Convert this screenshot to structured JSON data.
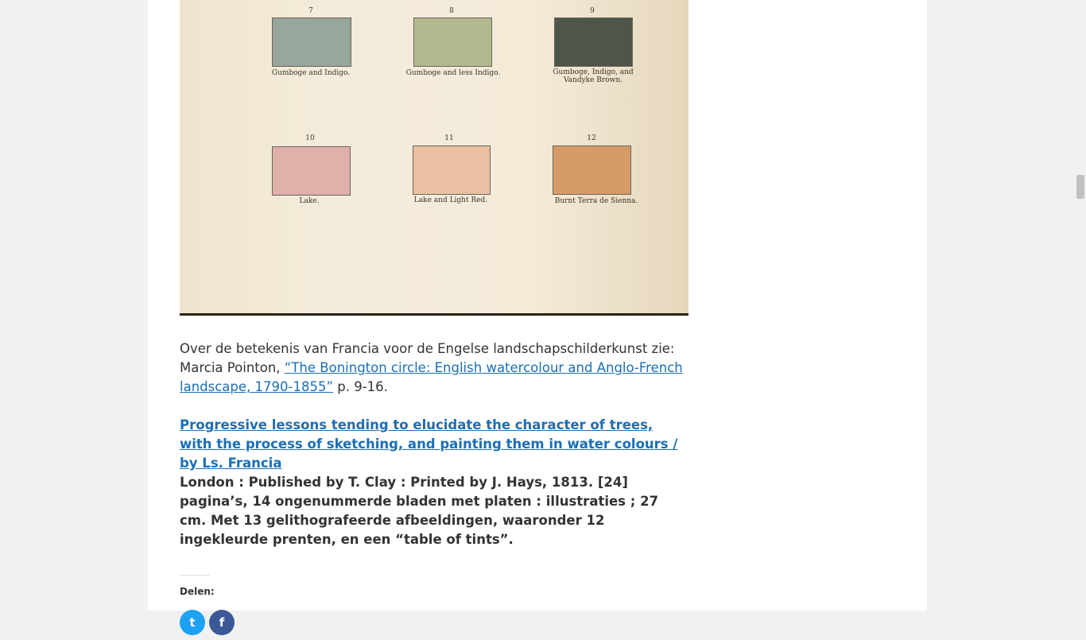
{
  "plate": {
    "swatches": [
      {
        "num": "7",
        "caption": "Gumboge and Indigo.",
        "color": "#98a69b"
      },
      {
        "num": "8",
        "caption": "Gumboge and less Indigo.",
        "color": "#b2b98f"
      },
      {
        "num": "9",
        "caption": "Gumboge, Indigo, and Vandyke Brown.",
        "color": "#4e5549"
      },
      {
        "num": "10",
        "caption": "Lake.",
        "color": "#e0b0ab"
      },
      {
        "num": "11",
        "caption": "Lake and Light Red.",
        "color": "#ebc0a3"
      },
      {
        "num": "12",
        "caption": "Burnt Terra de Sienna.",
        "color": "#d69b69"
      }
    ]
  },
  "article": {
    "para1_text": "Over de betekenis van Francia voor de Engelse landschapschilderkunst zie: Marcia Pointon, ",
    "para1_link": "“The Bonington circle: English watercolour and Anglo-French landscape, 1790-1855”",
    "para1_tail": " p. 9-16.",
    "book_link": "Progressive lessons tending to elucidate the character of trees, with the process of sketching, and painting them in water colours / by Ls. Francia",
    "book_meta": "London : Published by T. Clay : Printed by J. Hays, 1813. [24] pagina’s, 14 ongenummerde bladen met platen : illustraties ; 27 cm. Met 13 gelithografeerde afbeeldingen, waaronder 12 ingekleurde prenten, en een “table of tints”."
  },
  "share": {
    "label": "Delen:",
    "buttons": [
      {
        "icon": "twitter-icon",
        "color": "#1da1f2",
        "glyph": "t"
      },
      {
        "icon": "facebook-icon",
        "color": "#3b5998",
        "glyph": "f"
      }
    ]
  },
  "colors": {
    "link": "#1a6fb8",
    "page_bg": "#f1f1f1"
  }
}
